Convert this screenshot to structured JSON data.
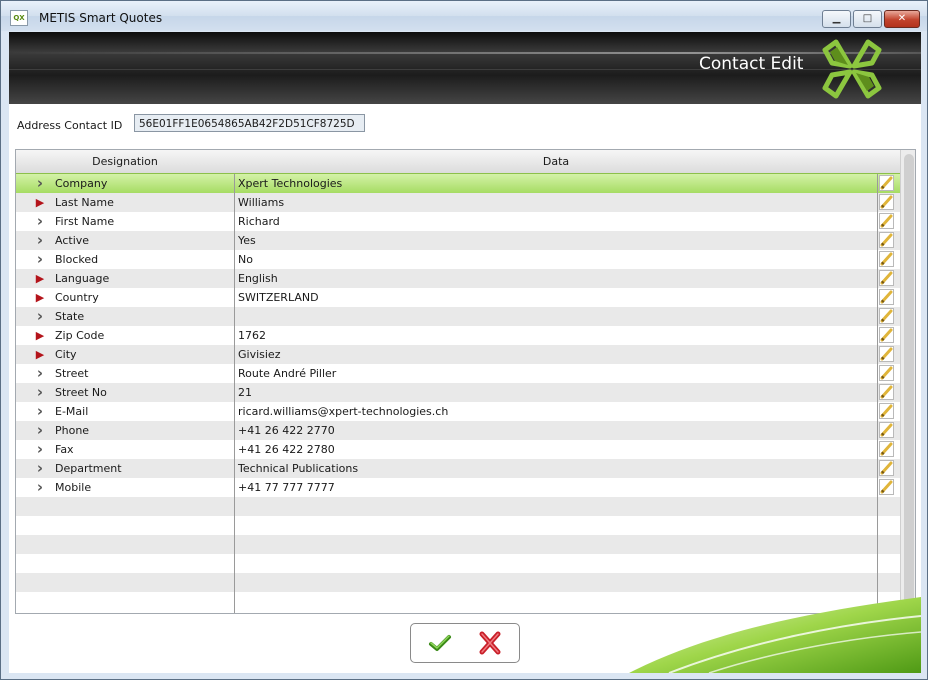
{
  "window": {
    "title": "METIS Smart Quotes",
    "icon_text": "QX",
    "minimize": "▁",
    "maximize": "□",
    "close": "✕"
  },
  "banner": {
    "title": "Contact Edit"
  },
  "address_contact": {
    "label": "Address Contact ID",
    "value": "56E01FF1E0654865AB42F2D51CF8725D"
  },
  "grid": {
    "headers": {
      "designation": "Designation",
      "data": "Data"
    },
    "rows": [
      {
        "name": "Company",
        "value": "Xpert Technologies",
        "required": false,
        "selected": true
      },
      {
        "name": "Last Name",
        "value": "Williams",
        "required": true,
        "selected": false
      },
      {
        "name": "First Name",
        "value": "Richard",
        "required": false,
        "selected": false
      },
      {
        "name": "Active",
        "value": "Yes",
        "required": false,
        "selected": false
      },
      {
        "name": "Blocked",
        "value": "No",
        "required": false,
        "selected": false
      },
      {
        "name": "Language",
        "value": "English",
        "required": true,
        "selected": false
      },
      {
        "name": "Country",
        "value": "SWITZERLAND",
        "required": true,
        "selected": false
      },
      {
        "name": "State",
        "value": "",
        "required": false,
        "selected": false
      },
      {
        "name": "Zip Code",
        "value": "1762",
        "required": true,
        "selected": false
      },
      {
        "name": "City",
        "value": "Givisiez",
        "required": true,
        "selected": false
      },
      {
        "name": "Street",
        "value": "Route André Piller",
        "required": false,
        "selected": false
      },
      {
        "name": "Street No",
        "value": "21",
        "required": false,
        "selected": false
      },
      {
        "name": "E-Mail",
        "value": "ricard.williams@xpert-technologies.ch",
        "required": false,
        "selected": false
      },
      {
        "name": "Phone",
        "value": "+41 26 422 2770",
        "required": false,
        "selected": false
      },
      {
        "name": "Fax",
        "value": "+41 26 422 2780",
        "required": false,
        "selected": false
      },
      {
        "name": "Department",
        "value": "Technical Publications",
        "required": false,
        "selected": false
      },
      {
        "name": "Mobile",
        "value": "+41 77 777 7777",
        "required": false,
        "selected": false
      }
    ],
    "empty_rows": 6
  },
  "icons": {
    "row_marker": "chevron-right-icon",
    "edit": "pencil-icon",
    "ok": "checkmark-icon",
    "cancel": "x-icon"
  },
  "colors": {
    "selection": "#a6dc63",
    "required_marker": "#b4141b",
    "accent_green": "#8cc63f"
  }
}
